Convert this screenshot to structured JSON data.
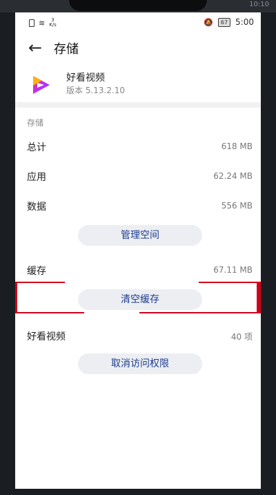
{
  "status_bar": {
    "net_speed": "3\nK/s",
    "battery": "67",
    "time": "5:00",
    "notch_time": "10:10"
  },
  "header": {
    "title": "存储"
  },
  "app": {
    "name": "好看视频",
    "version": "版本 5.13.2.10"
  },
  "storage": {
    "section_label": "存储",
    "total_label": "总计",
    "total_value": "618 MB",
    "app_label": "应用",
    "app_value": "62.24 MB",
    "data_label": "数据",
    "data_value": "556 MB",
    "manage_button": "管理空间",
    "cache_label": "缓存",
    "cache_value": "67.11 MB",
    "clear_cache_button": "清空缓存",
    "items_label": "好看视频",
    "items_value": "40 项",
    "revoke_button": "取消访问权限"
  },
  "colors": {
    "accent": "#1d3c8f",
    "highlight": "#d0021b"
  }
}
